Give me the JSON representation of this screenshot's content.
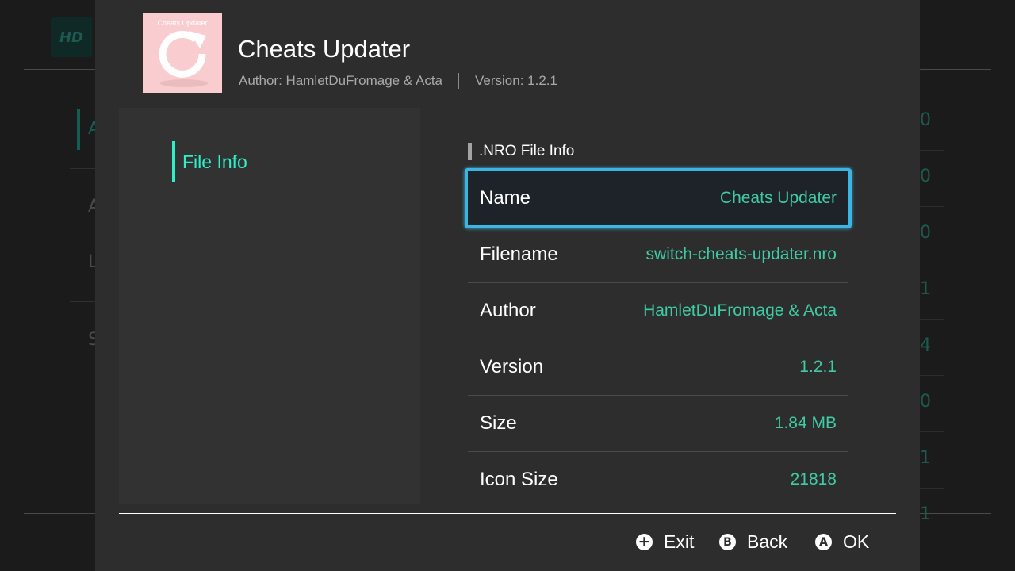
{
  "background": {
    "logo_text": "HD",
    "left_letters": [
      "A",
      "A",
      "L",
      "S"
    ],
    "right_values": [
      "0",
      "0",
      "0",
      "1",
      "4",
      "0",
      "1",
      "1"
    ]
  },
  "app": {
    "icon_caption": "Cheats Updater",
    "title": "Cheats Updater",
    "author_line": "Author: HamletDuFromage & Acta",
    "version_line": "Version: 1.2.1"
  },
  "sidebar": {
    "items": [
      {
        "label": "File Info",
        "selected": true
      }
    ]
  },
  "section": {
    "title": ".NRO File Info"
  },
  "file_info": [
    {
      "key": "Name",
      "value": "Cheats Updater"
    },
    {
      "key": "Filename",
      "value": "switch-cheats-updater.nro"
    },
    {
      "key": "Author",
      "value": "HamletDuFromage & Acta"
    },
    {
      "key": "Version",
      "value": "1.2.1"
    },
    {
      "key": "Size",
      "value": "1.84 MB"
    },
    {
      "key": "Icon Size",
      "value": "21818"
    }
  ],
  "footer": {
    "exit": {
      "glyph": "+",
      "label": "Exit"
    },
    "back": {
      "glyph": "B",
      "label": "Back"
    },
    "ok": {
      "glyph": "A",
      "label": "OK"
    }
  },
  "colors": {
    "accent": "#2ef0c8",
    "value_text": "#3fcba4",
    "selection_border": "#3bb6e3",
    "modal_bg": "#2d2d2d",
    "icon_bg": "#f9cdd0"
  }
}
